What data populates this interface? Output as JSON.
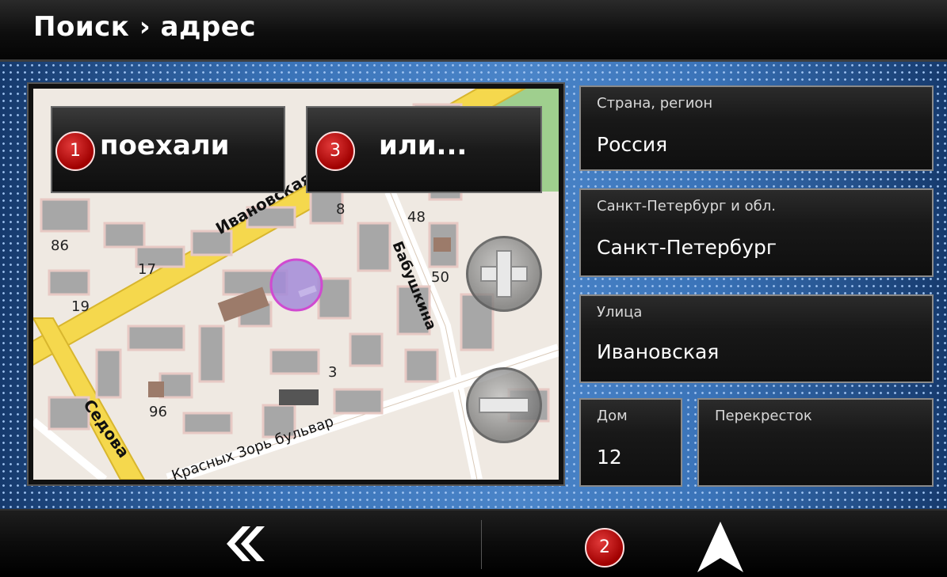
{
  "header": {
    "title": "Поиск › адрес"
  },
  "map": {
    "go_button": {
      "badge": "1",
      "label": "поехали"
    },
    "or_button": {
      "badge": "3",
      "label": "или..."
    },
    "house_labels": [
      "86",
      "17",
      "19",
      "8",
      "48",
      "50",
      "3",
      "96"
    ],
    "street_labels": [
      "Ивановская",
      "Бабушкина",
      "Седова",
      "Красных Зорь бульвар"
    ]
  },
  "fields": {
    "country": {
      "caption": "Страна, регион",
      "value": "Россия"
    },
    "city": {
      "caption": "Санкт-Петербург и обл.",
      "value": "Санкт-Петербург"
    },
    "street": {
      "caption": "Улица",
      "value": "Ивановская"
    },
    "house": {
      "caption": "Дом",
      "value": "12"
    },
    "crossing": {
      "caption": "Перекресток",
      "value": ""
    }
  },
  "footer": {
    "center_badge": "2"
  }
}
